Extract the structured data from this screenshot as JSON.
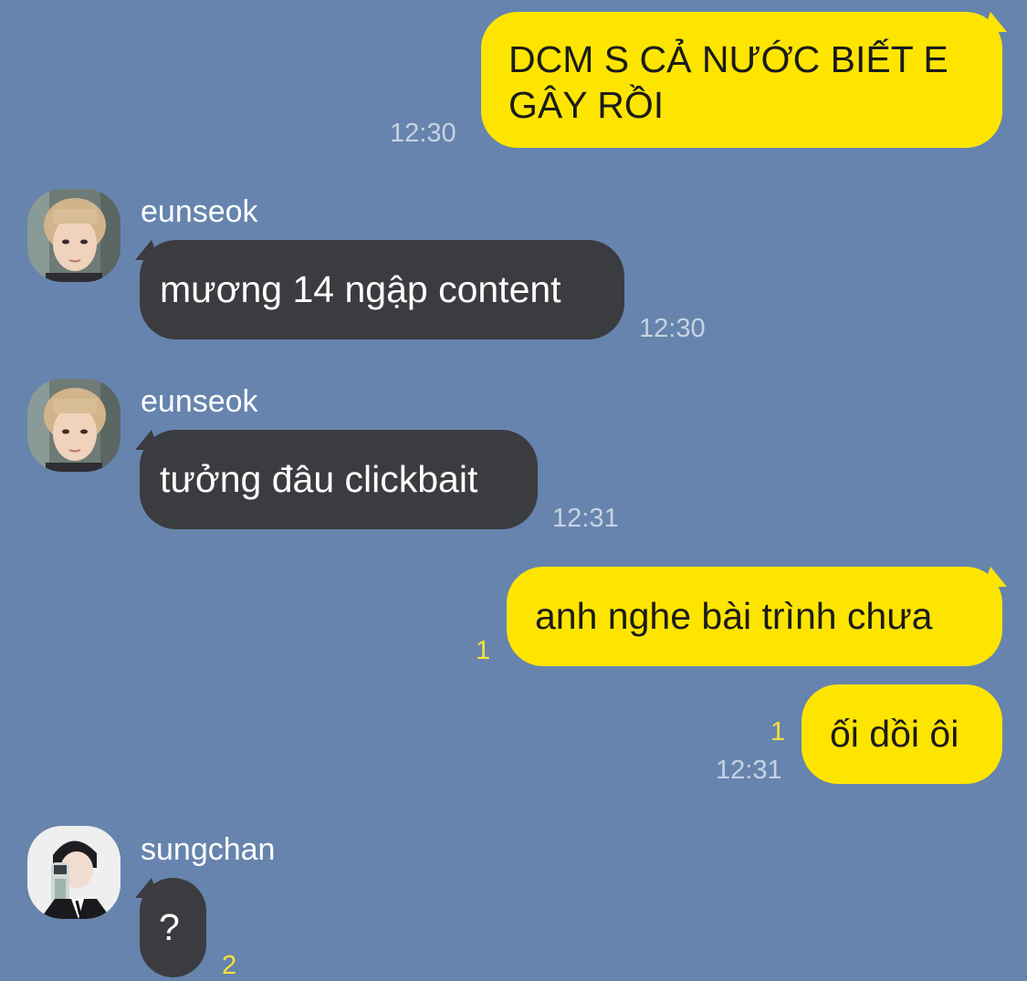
{
  "colors": {
    "background": "#6684ae",
    "outgoing_bubble": "#fee500",
    "incoming_bubble": "#3b3c40",
    "unread_count": "#f7e23a"
  },
  "messages": [
    {
      "direction": "out",
      "text": "DCM S CẢ NƯỚC BIẾT E GÂY RỒI",
      "time": "12:30"
    },
    {
      "direction": "in",
      "sender": "eunseok",
      "text": "mương 14 ngập content",
      "time": "12:30"
    },
    {
      "direction": "in",
      "sender": "eunseok",
      "text": "tưởng đâu clickbait",
      "time": "12:31"
    },
    {
      "direction": "out",
      "text": "anh nghe bài trình chưa",
      "unread": "1"
    },
    {
      "direction": "out",
      "text": "ối dồi ôi",
      "unread": "1",
      "time": "12:31"
    },
    {
      "direction": "in",
      "sender": "sungchan",
      "text": "?",
      "unread": "2"
    }
  ]
}
